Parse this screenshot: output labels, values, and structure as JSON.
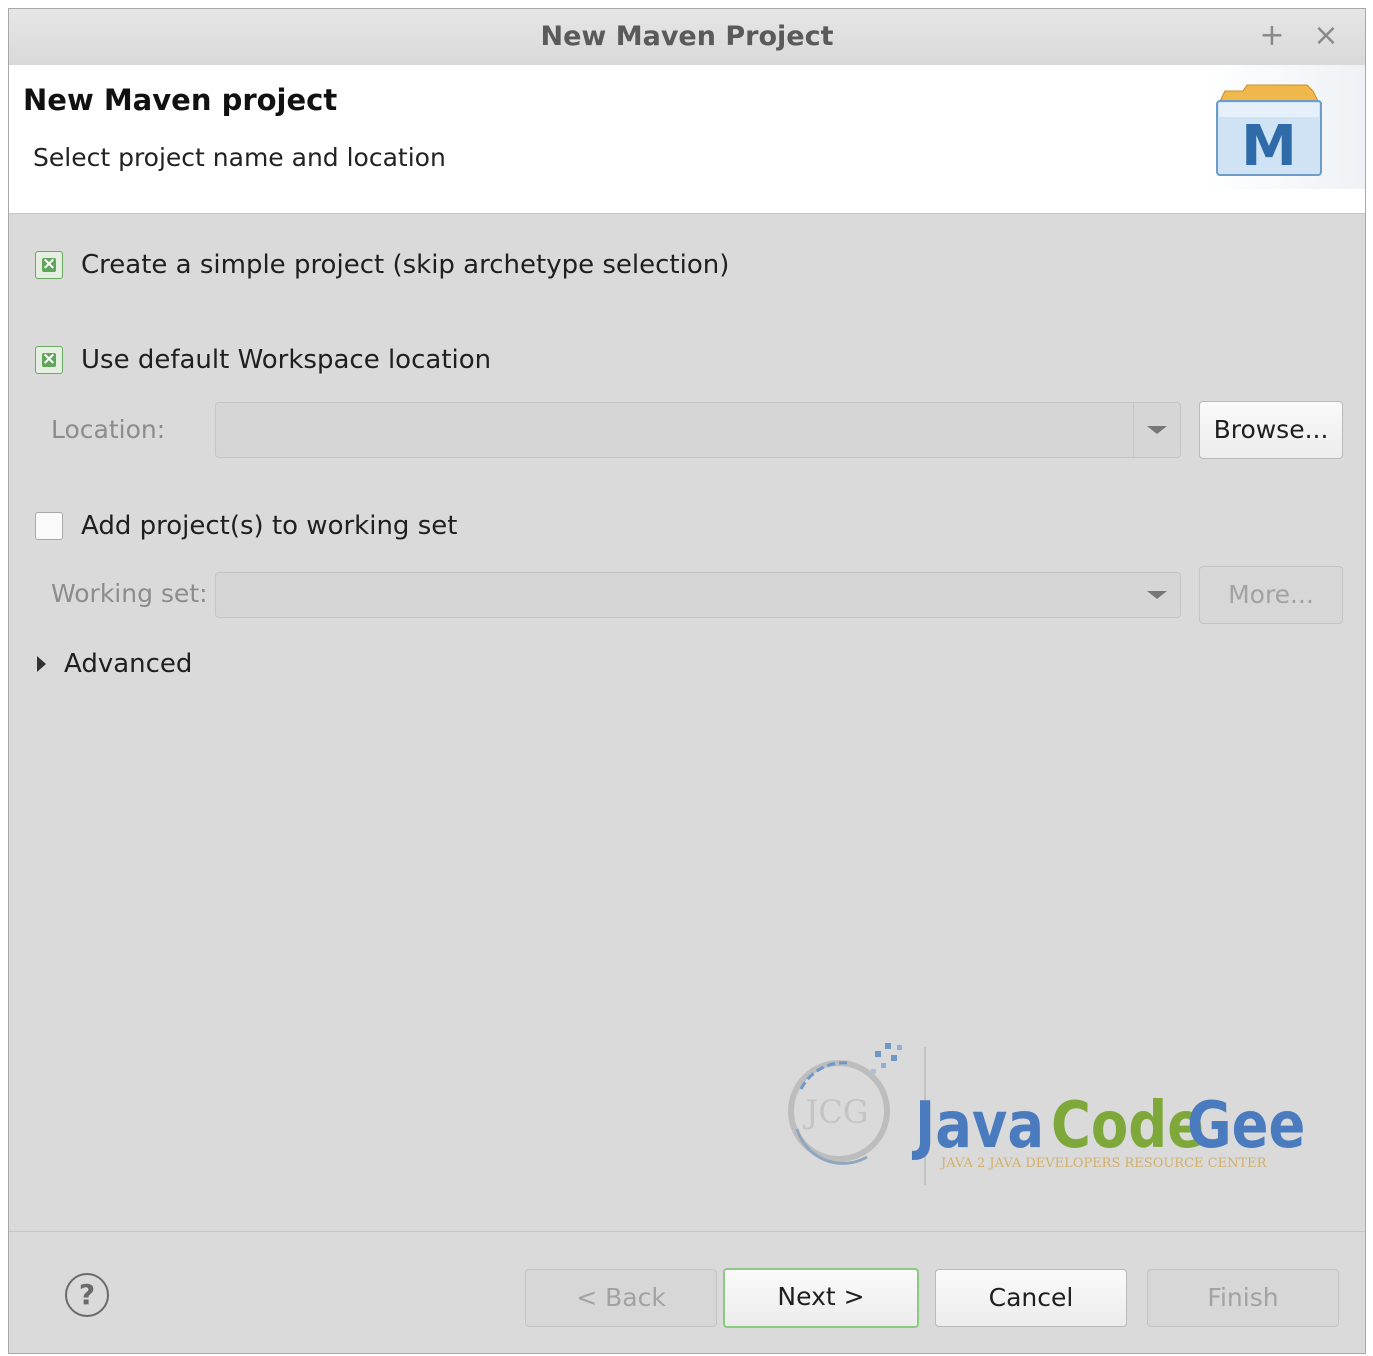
{
  "window": {
    "title": "New Maven Project",
    "controls": {
      "maximize": "+",
      "close": "×"
    }
  },
  "banner": {
    "heading": "New Maven project",
    "subheading": "Select project name and location",
    "logo_letter": "M"
  },
  "options": {
    "simple_project": {
      "label": "Create a simple project (skip archetype selection)",
      "checked": true
    },
    "default_location": {
      "label": "Use default Workspace location",
      "checked": true
    },
    "working_set_toggle": {
      "label": "Add project(s) to working set",
      "checked": false
    }
  },
  "location": {
    "label": "Location:",
    "value": "",
    "browse_label": "Browse..."
  },
  "working_set": {
    "label": "Working set:",
    "value": "",
    "more_label": "More..."
  },
  "advanced": {
    "label": "Advanced",
    "expanded": false
  },
  "watermark": {
    "initials": "JCG",
    "word1": "Java",
    "word2": "Code",
    "word3": "Geeks",
    "tagline": "JAVA 2 JAVA DEVELOPERS RESOURCE CENTER"
  },
  "footer": {
    "help_glyph": "?",
    "back_label": "< Back",
    "next_label": "Next >",
    "cancel_label": "Cancel",
    "finish_label": "Finish"
  },
  "colors": {
    "accent_green": "#8cc982",
    "checkbox_green": "#5fa55a",
    "dialog_bg": "#dadada",
    "watermark_blue": "#4a7bbf",
    "watermark_green": "#7fa83a"
  }
}
